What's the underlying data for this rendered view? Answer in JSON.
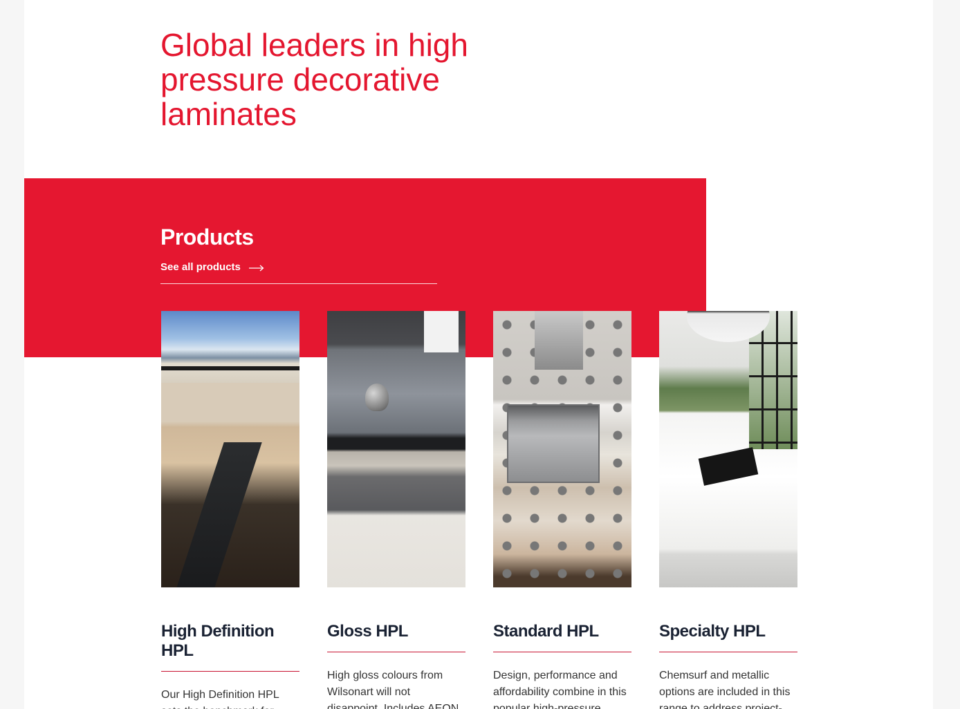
{
  "hero": {
    "title": "Global leaders in high pressure decorative laminates"
  },
  "products": {
    "heading": "Products",
    "see_all_label": "See all products",
    "cards": [
      {
        "title": "High Definition HPL",
        "description": "Our High Definition HPL sets the benchmark for"
      },
      {
        "title": "Gloss HPL",
        "description": "High gloss colours from Wilsonart will not disappoint. Includes AEON"
      },
      {
        "title": "Standard HPL",
        "description": "Design, performance and affordability combine in this popular high-pressure"
      },
      {
        "title": "Specialty HPL",
        "description": "Chemsurf and metallic options are included in this range to address project-"
      }
    ]
  },
  "colors": {
    "brand_red": "#e51730",
    "heading_dark": "#1a2233"
  }
}
